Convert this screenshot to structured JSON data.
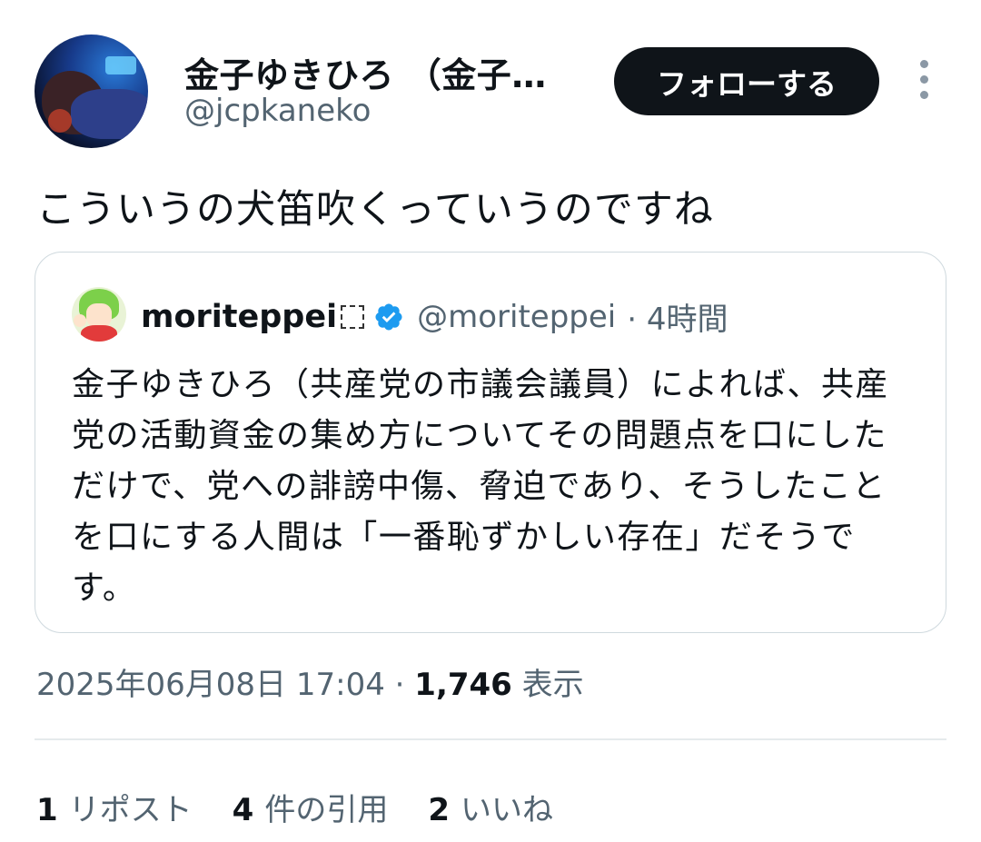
{
  "author": {
    "display_name": "金子ゆきひろ （金子…",
    "handle": "@jcpkaneko"
  },
  "follow_button_label": "フォローする",
  "tweet_text": "こういうの犬笛吹くっていうのですね",
  "quoted_tweet": {
    "display_name": "moriteppei",
    "handle": "@moriteppei",
    "time": "· 4時間",
    "text": "金子ゆきひろ（共産党の市議会議員）によれば、共産党の活動資金の集め方についてその問題点を口にしただけで、党への誹謗中傷、脅迫であり、そうしたことを口にする人間は「一番恥ずかしい存在」だそうです。"
  },
  "meta": {
    "timestamp": "2025年06月08日 17:04 ·",
    "views_count": "1,746",
    "views_label": "表示"
  },
  "stats": [
    {
      "count": "1",
      "label": "リポスト"
    },
    {
      "count": "4",
      "label": "件の引用"
    },
    {
      "count": "2",
      "label": "いいね"
    }
  ],
  "colors": {
    "text_primary": "#0f1419",
    "text_secondary": "#536471",
    "border": "#cfd9de",
    "verified": "#1d9bf0"
  }
}
